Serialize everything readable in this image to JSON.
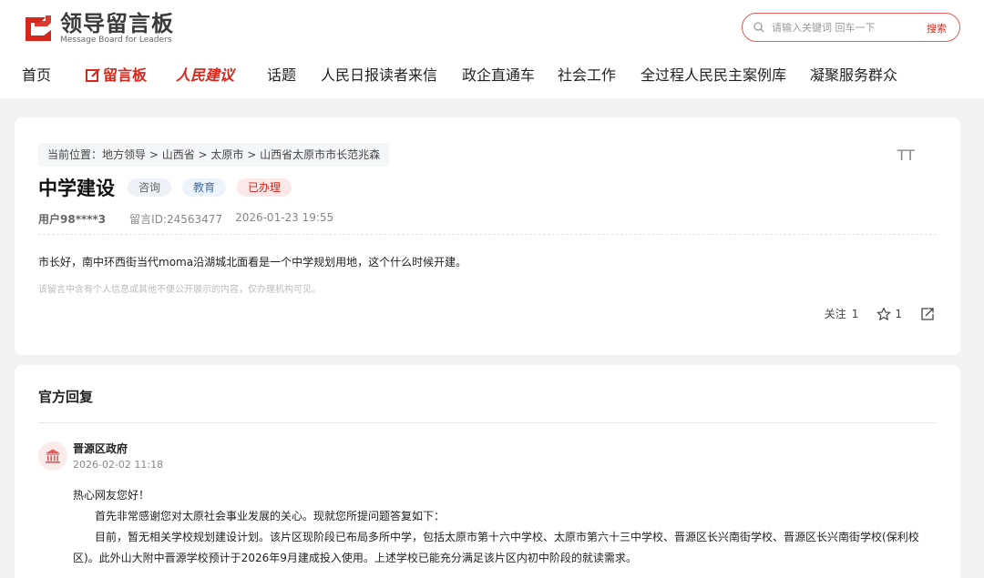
{
  "header": {
    "logo_title": "领导留言板",
    "logo_sub": "Message Board for Leaders",
    "search_placeholder": "请输入关键词 回车一下",
    "search_button": "搜索",
    "accent": "#d7261b"
  },
  "nav": [
    {
      "label": "首页"
    },
    {
      "label": "留言板"
    },
    {
      "label": "人民建议"
    },
    {
      "label": "话题"
    },
    {
      "label": "人民日报读者来信"
    },
    {
      "label": "政企直通车"
    },
    {
      "label": "社会工作"
    },
    {
      "label": "全过程人民民主案例库"
    },
    {
      "label": "凝聚服务群众"
    }
  ],
  "message": {
    "breadcrumb": [
      "当前位置：",
      "地方领导",
      " > ",
      "山西省",
      " > ",
      "太原市",
      " > ",
      "山西省太原市市长范兆森"
    ],
    "title": "中学建设",
    "tags": [
      "咨询",
      "教育",
      "已办理"
    ],
    "user": "用户98****3",
    "message_id": "留言ID:24563477",
    "time": "2026-01-23 19:55",
    "content": "市长好，南中环西街当代moma沿湖城北面看是一个中学规划用地，这个什么时候开建。",
    "privacy_notice": "该留言中含有个人信息或其他不便公开展示的内容，仅办理机构可见。",
    "follow_label": "关注",
    "follow_count": "1",
    "star_count": "1",
    "font_icon": "TT"
  },
  "reply": {
    "section_title": "官方回复",
    "org_name": "晋源区政府",
    "date": "2026-02-02 11:18",
    "paragraphs": [
      "热心网友您好！",
      "首先非常感谢您对太原社会事业发展的关心。现就您所提问题答复如下：",
      "目前，暂无相关学校规划建设计划。该片区现阶段已布局多所中学，包括太原市第十六中学校、太原市第六十三中学校、晋源区长兴南街学校、晋源区长兴南街学校(保利校区)。此外山大附中晋源学校预计于2026年9月建成投入使用。上述学校已能充分满足该片区内初中阶段的就读需求。"
    ]
  }
}
